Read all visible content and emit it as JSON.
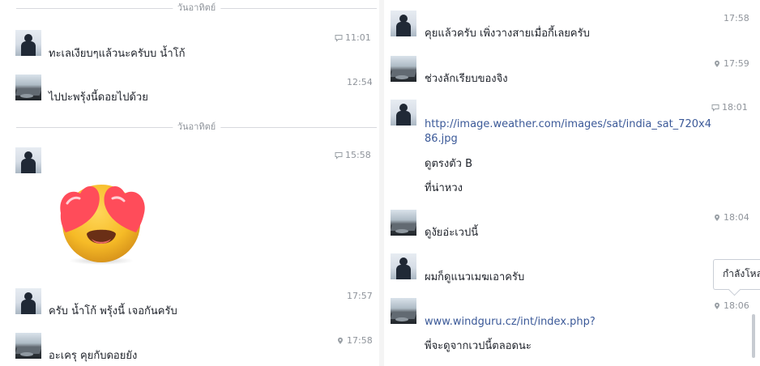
{
  "left_panel": {
    "dividers": [
      {
        "label": "วันอาทิตย์"
      },
      {
        "label": "วันอาทิตย์"
      }
    ],
    "messages": [
      {
        "avatar": "profile-photo",
        "status_icon": "message-icon",
        "time": "11:01",
        "text": "ทะเลเงียบๆแล้วนะครับบ น้ำโก้"
      },
      {
        "avatar": "profile-photo",
        "status_icon": "",
        "time": "12:54",
        "text": "ไปปะพรุ้งนี้ดอยไปด้วย"
      },
      {
        "avatar": "profile-photo",
        "status_icon": "message-icon",
        "time": "15:58",
        "text": ""
      },
      {
        "avatar": "profile-photo",
        "status_icon": "",
        "time": "17:57",
        "text": "ครับ น้ำโก้ พรุ้งนี้ เจอกันครับ"
      },
      {
        "avatar": "profile-photo",
        "status_icon": "location-icon",
        "time": "17:58",
        "text": "อะเครุ คุยกับดอยยัง"
      }
    ],
    "sticker": {
      "icon": "heart-eyes-emoji"
    }
  },
  "right_panel": {
    "messages": [
      {
        "avatar": "profile-photo",
        "status_icon": "",
        "time": "17:58",
        "text": "คุยแล้วครับ เพิ่งวางสายเมื่อกี้เลยครับ"
      },
      {
        "avatar": "profile-photo",
        "status_icon": "location-icon",
        "time": "17:59",
        "text": "ช่วงลักเรียบของจิง"
      },
      {
        "avatar": "profile-photo",
        "status_icon": "message-icon",
        "time": "18:01",
        "link": "http://image.weather.com/images/sat/india_sat_720x486.jpg",
        "extra_lines": [
          "ดูตรงตัว B",
          "ที่น่าหวง"
        ]
      },
      {
        "avatar": "profile-photo",
        "status_icon": "location-icon",
        "time": "18:04",
        "text": "ดูงัยอ่ะเวปนี้"
      },
      {
        "avatar": "profile-photo",
        "status_icon": "",
        "time": "",
        "text": "ผมก็ดูแนวเมฆเอาครับ"
      },
      {
        "avatar": "profile-photo",
        "status_icon": "location-icon",
        "time": "18:06",
        "link": "www.windguru.cz/int/index.php?",
        "extra_lines": [
          "พี่จะดูจากเวปนี้ตลอดนะ"
        ]
      }
    ],
    "tooltip": {
      "text": "กำลังโหล"
    }
  },
  "colors": {
    "text": "#1d2129",
    "meta": "#8f949b",
    "link": "#3b5998",
    "divider": "#d7d9de"
  }
}
